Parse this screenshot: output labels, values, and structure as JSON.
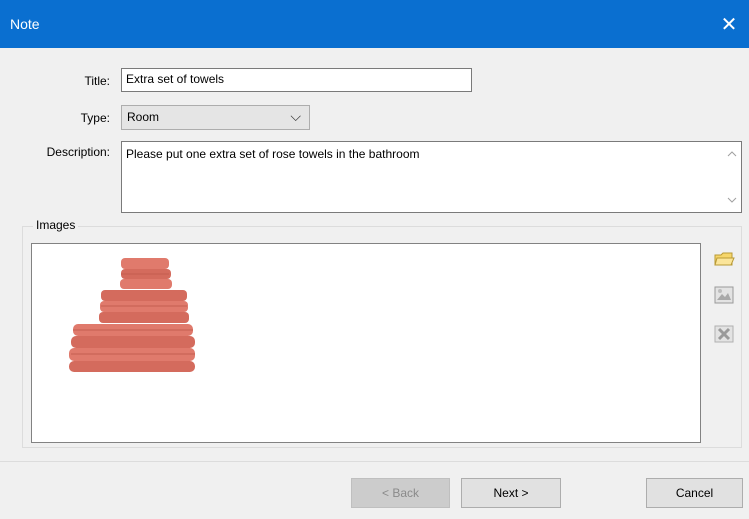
{
  "window": {
    "title": "Note",
    "close_glyph": "✕"
  },
  "form": {
    "title_label": "Title:",
    "title_value": "Extra set of towels",
    "type_label": "Type:",
    "type_value": "Room",
    "description_label": "Description:",
    "description_value": "Please put one extra set of rose towels in the bathroom"
  },
  "images": {
    "group_label": "Images",
    "thumbnail_icon": "towel-stack-image",
    "side_buttons": [
      "open-folder-icon",
      "picture-icon",
      "delete-x-icon"
    ]
  },
  "footer": {
    "back_label": "< Back",
    "next_label": "Next >",
    "cancel_label": "Cancel"
  },
  "colors": {
    "titlebar": "#0a6fd0",
    "towel": "#e07a6c"
  }
}
